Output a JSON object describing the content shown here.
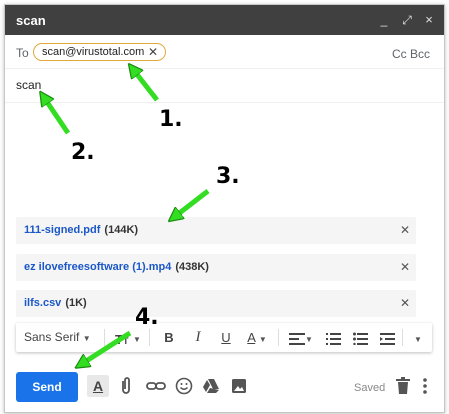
{
  "window": {
    "title": "scan",
    "minimize_glyph": "_",
    "fullscreen_glyph": "⤢",
    "close_glyph": "×"
  },
  "to": {
    "label": "To",
    "recipient": "scan@virustotal.com",
    "cc_bcc": "Cc Bcc"
  },
  "subject": "scan",
  "attachments": [
    {
      "name": "111-signed.pdf",
      "size": "(144K)"
    },
    {
      "name": "ez ilovefreesoftware (1).mp4",
      "size": "(438K)"
    },
    {
      "name": "ilfs.csv",
      "size": "(1K)"
    }
  ],
  "format": {
    "font": "Sans Serif"
  },
  "send_label": "Send",
  "saved_label": "Saved",
  "annotations": [
    "1.",
    "2.",
    "3.",
    "4."
  ],
  "colors": {
    "titlebar": "#404040",
    "send": "#1a73e8",
    "arrow": "#33dd22",
    "chip_border": "#e0a93c"
  },
  "icons": [
    "formatting-icon",
    "attach-icon",
    "link-icon",
    "emoji-icon",
    "drive-icon",
    "photo-icon",
    "trash-icon",
    "more-options-icon"
  ]
}
